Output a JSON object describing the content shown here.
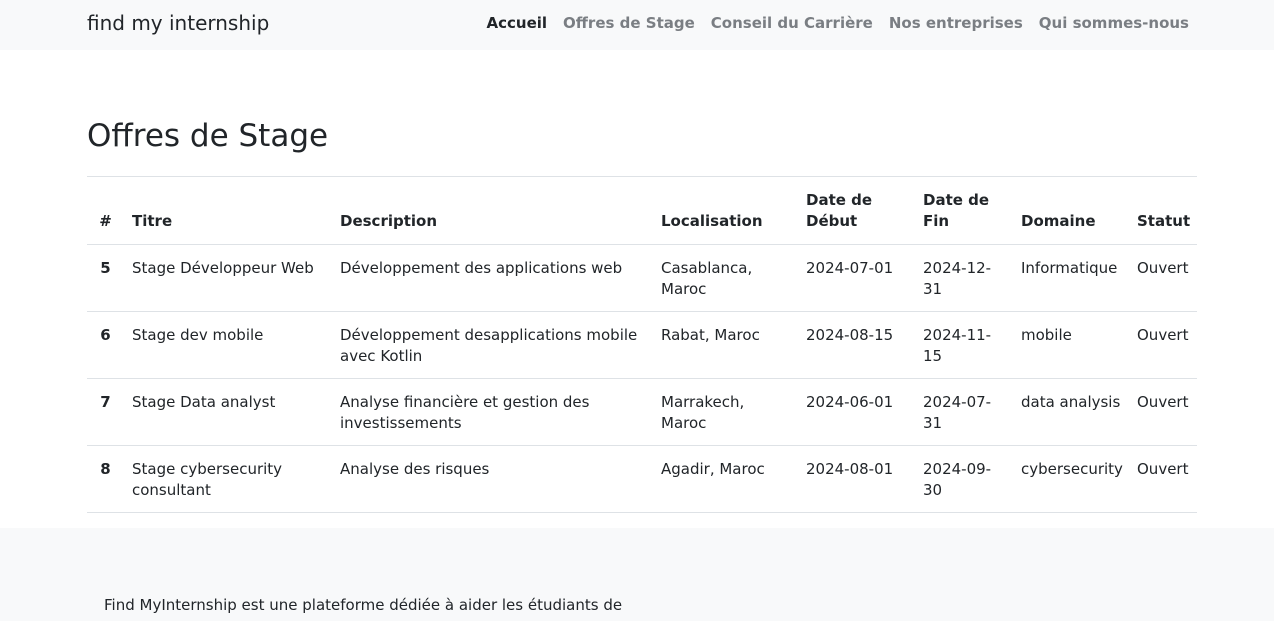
{
  "navbar": {
    "brand": "find my internship",
    "links": [
      "Accueil",
      "Offres de Stage",
      "Conseil du Carrière",
      "Nos entreprises",
      "Qui sommes-nous"
    ]
  },
  "page": {
    "title": "Offres de Stage"
  },
  "table": {
    "headers": [
      "#",
      "Titre",
      "Description",
      "Localisation",
      "Date de Début",
      "Date de Fin",
      "Domaine",
      "Statut"
    ],
    "rows": [
      [
        "5",
        "Stage Développeur Web",
        "Développement des applications web",
        "Casablanca, Maroc",
        "2024-07-01",
        "2024-12-31",
        "Informatique",
        "Ouvert"
      ],
      [
        "6",
        "Stage dev mobile",
        "Développement desapplications mobile avec Kotlin",
        "Rabat, Maroc",
        "2024-08-15",
        "2024-11-15",
        "mobile",
        "Ouvert"
      ],
      [
        "7",
        "Stage Data analyst",
        "Analyse financière et gestion des investissements",
        "Marrakech, Maroc",
        "2024-06-01",
        "2024-07-31",
        "data analysis",
        "Ouvert"
      ],
      [
        "8",
        "Stage cybersecurity consultant",
        "Analyse des risques",
        "Agadir, Maroc",
        "2024-08-01",
        "2024-09-30",
        "cybersecurity",
        "Ouvert"
      ]
    ]
  },
  "footer": {
    "text": "Find MyInternship est une plateforme dédiée à aider les étudiants de"
  }
}
